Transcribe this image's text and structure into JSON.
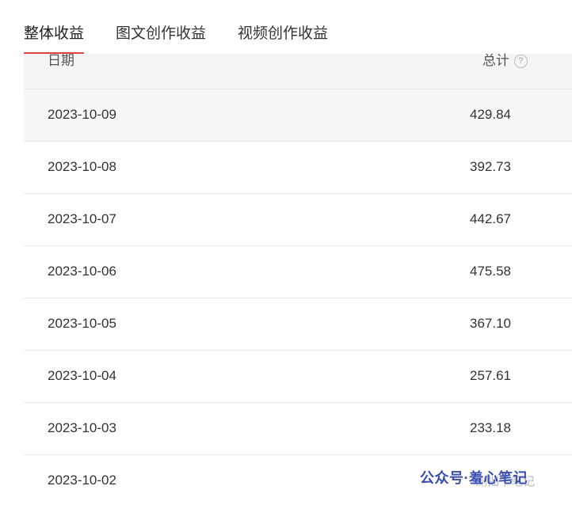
{
  "tabs": [
    {
      "label": "整体收益",
      "active": true
    },
    {
      "label": "图文创作收益",
      "active": false
    },
    {
      "label": "视频创作收益",
      "active": false
    }
  ],
  "table": {
    "columns": {
      "date": "日期",
      "total": "总计",
      "total_help_icon": "question-circle-icon"
    },
    "rows": [
      {
        "date": "2023-10-09",
        "total": "429.84"
      },
      {
        "date": "2023-10-08",
        "total": "392.73"
      },
      {
        "date": "2023-10-07",
        "total": "442.67"
      },
      {
        "date": "2023-10-06",
        "total": "475.58"
      },
      {
        "date": "2023-10-05",
        "total": "367.10"
      },
      {
        "date": "2023-10-04",
        "total": "257.61"
      },
      {
        "date": "2023-10-03",
        "total": "233.18"
      },
      {
        "date": "2023-10-02",
        "total": ""
      }
    ]
  },
  "watermark": {
    "text": "公众号·羞心笔记",
    "sub_text": "测拙干笔记"
  },
  "colors": {
    "active_tab_underline": "#e2423e",
    "header_bg": "#f5f5f5",
    "hover_row_bg": "#f7f7f7",
    "watermark": "#3a4db0"
  }
}
